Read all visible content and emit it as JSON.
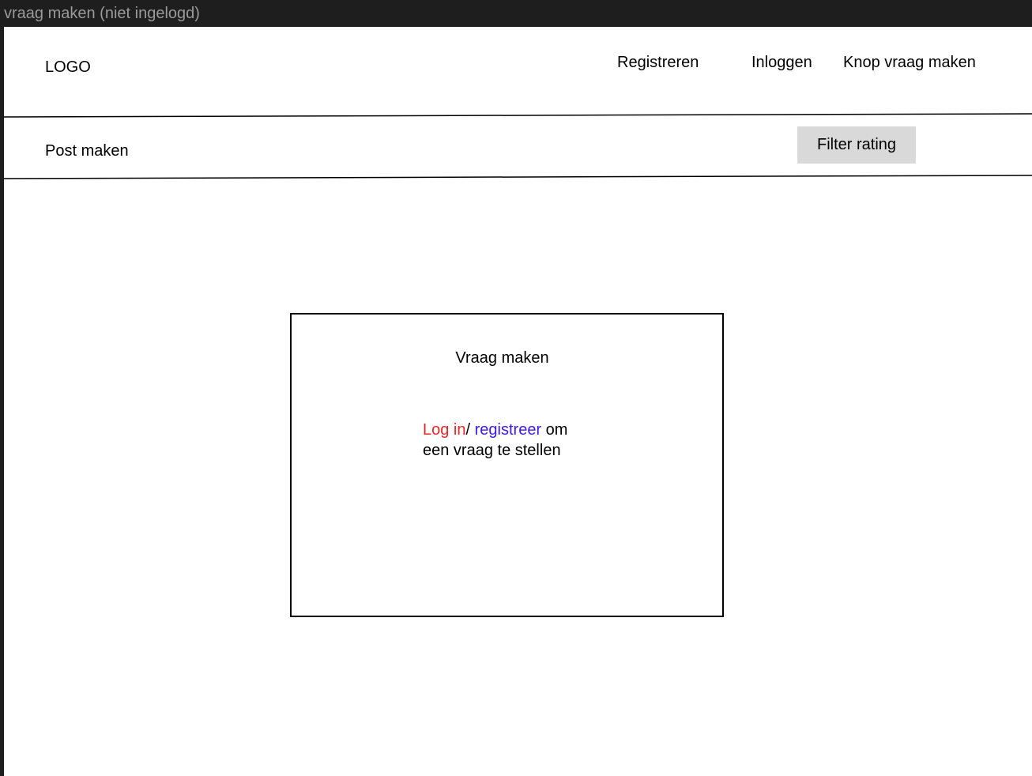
{
  "frame": {
    "title": "vraag maken (niet ingelogd)"
  },
  "header": {
    "logo": "LOGO",
    "nav": {
      "register": "Registreren",
      "login": "Inloggen",
      "ask_question": "Knop vraag maken"
    }
  },
  "toolbar": {
    "post_maken": "Post maken",
    "filter_rating": "Filter rating"
  },
  "modal": {
    "title": "Vraag maken",
    "login_link": "Log in",
    "separator": "/ ",
    "register_link": "registreer",
    "message_rest_1": " om",
    "message_rest_2": "een vraag te stellen"
  },
  "colors": {
    "login_link": "#e8262a",
    "register_link": "#3d17f0",
    "filter_button_bg": "#d9d9d9",
    "frame_background": "#1e1e1e"
  }
}
